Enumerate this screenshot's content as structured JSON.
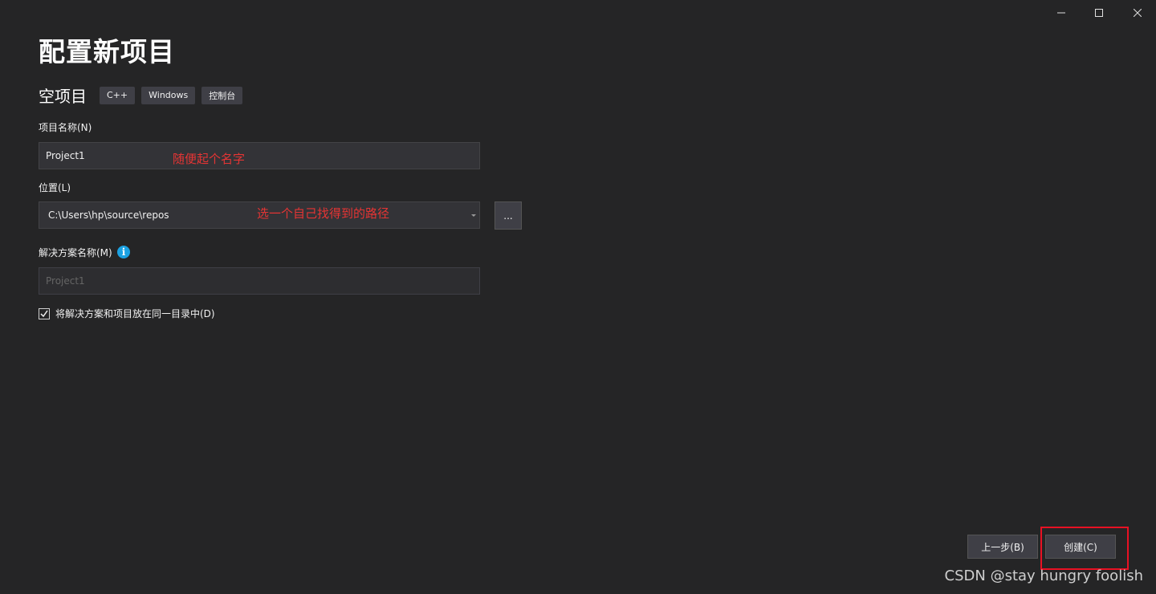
{
  "window": {
    "minimize_icon": "minimize-icon",
    "maximize_icon": "maximize-icon",
    "close_icon": "close-icon"
  },
  "title": "配置新项目",
  "template": {
    "name": "空项目",
    "tags": [
      "C++",
      "Windows",
      "控制台"
    ]
  },
  "project_name": {
    "label": "项目名称(N)",
    "value": "Project1",
    "annotation": "随便起个名字"
  },
  "location": {
    "label": "位置(L)",
    "value": "C:\\Users\\hp\\source\\repos",
    "browse_label": "...",
    "annotation": "选一个自己找得到的路径"
  },
  "solution_name": {
    "label": "解决方案名称(M)",
    "info_icon": "i",
    "placeholder": "Project1"
  },
  "same_dir": {
    "label": "将解决方案和项目放在同一目录中(D)",
    "checked": true
  },
  "footer": {
    "back_label": "上一步(B)",
    "create_label": "创建(C)"
  },
  "watermark": "CSDN @stay hungry foolish",
  "colors": {
    "background": "#252526",
    "annotation": "#e53434",
    "highlight": "#e81123",
    "info": "#1ba1e2"
  }
}
